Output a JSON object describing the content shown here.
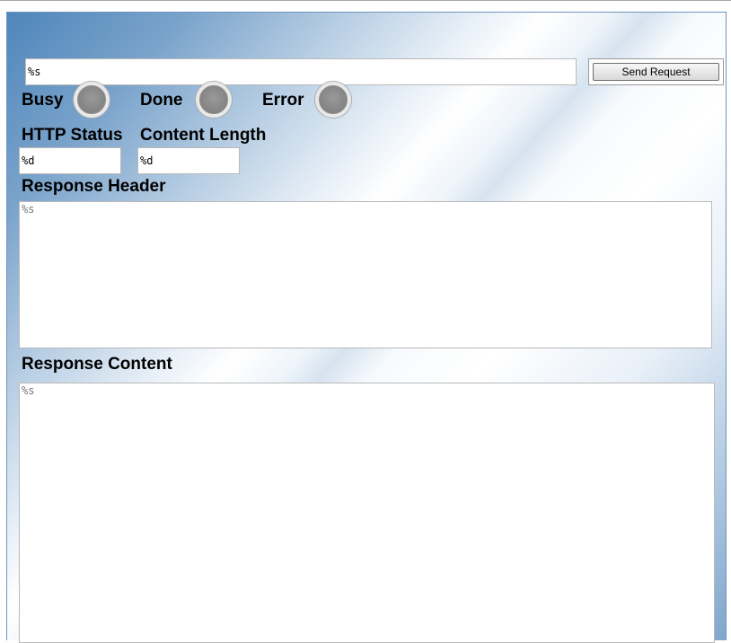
{
  "request": {
    "url_value": "%s",
    "send_label": "Send Request"
  },
  "indicators": [
    {
      "label": "Busy",
      "color": "#8a8a8a"
    },
    {
      "label": "Done",
      "color": "#8a8a8a"
    },
    {
      "label": "Error",
      "color": "#8a8a8a"
    }
  ],
  "status": {
    "http_status_label": "HTTP Status",
    "http_status_value": "%d",
    "content_length_label": "Content Length",
    "content_length_value": "%d"
  },
  "response": {
    "header_label": "Response Header",
    "header_value": "%s",
    "content_label": "Response Content",
    "content_value": "%s"
  }
}
